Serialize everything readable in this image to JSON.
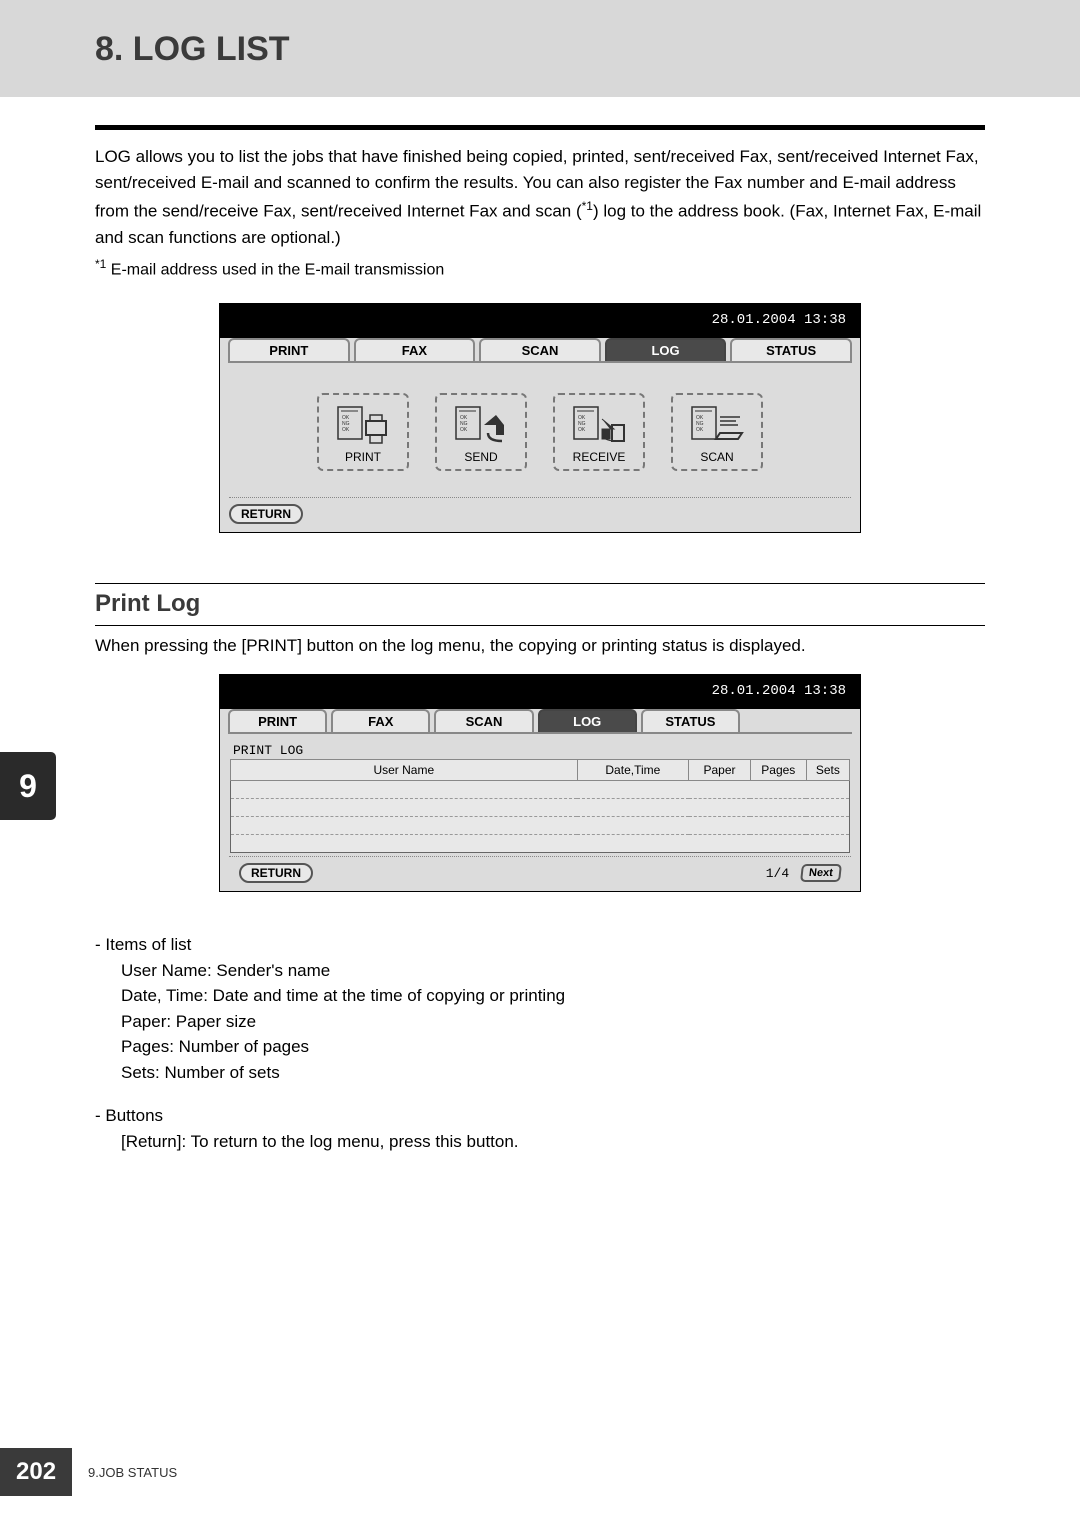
{
  "page": {
    "title": "8. LOG LIST"
  },
  "intro": {
    "paragraph": "LOG allows you to list the jobs that have finished being copied, printed, sent/received Fax, sent/received Internet Fax, sent/received E-mail and scanned to confirm the results. You can also register the Fax number and E-mail address from the send/receive Fax, sent/received Internet Fax and scan (",
    "sup": "*1",
    "paragraph_after": ") log to the address book. (Fax, Internet Fax, E-mail and scan functions are optional.)",
    "footnote_sup": "*1",
    "footnote": " E-mail address used in the E-mail transmission"
  },
  "screen1": {
    "datetime": "28.01.2004 13:38",
    "tabs": {
      "print": "PRINT",
      "fax": "FAX",
      "scan": "SCAN",
      "log": "LOG",
      "status": "STATUS"
    },
    "icons": {
      "print": "PRINT",
      "send": "SEND",
      "receive": "RECEIVE",
      "scan": "SCAN"
    },
    "return": "RETURN"
  },
  "section": {
    "heading": "Print Log",
    "intro": "When pressing the [PRINT] button on the log menu, the copying or printing status is displayed."
  },
  "screen2": {
    "datetime": "28.01.2004 13:38",
    "tabs": {
      "print": "PRINT",
      "fax": "FAX",
      "scan": "SCAN",
      "log": "LOG",
      "status": "STATUS"
    },
    "subtitle": "PRINT LOG",
    "columns": {
      "user": "User Name",
      "datetime": "Date,Time",
      "paper": "Paper",
      "pages": "Pages",
      "sets": "Sets"
    },
    "return": "RETURN",
    "pageinfo": "1/4",
    "next": "Next"
  },
  "list1": {
    "title": "-  Items of list",
    "i1": "User Name: Sender's name",
    "i2": "Date, Time: Date and time at the time of copying or printing",
    "i3": "Paper: Paper size",
    "i4": "Pages: Number of pages",
    "i5": "Sets: Number of sets"
  },
  "list2": {
    "title": "-  Buttons",
    "i1": "[Return]: To return to the log menu, press this button."
  },
  "chapter": {
    "num": "9"
  },
  "footer": {
    "page_num": "202",
    "label": "9.JOB STATUS"
  }
}
